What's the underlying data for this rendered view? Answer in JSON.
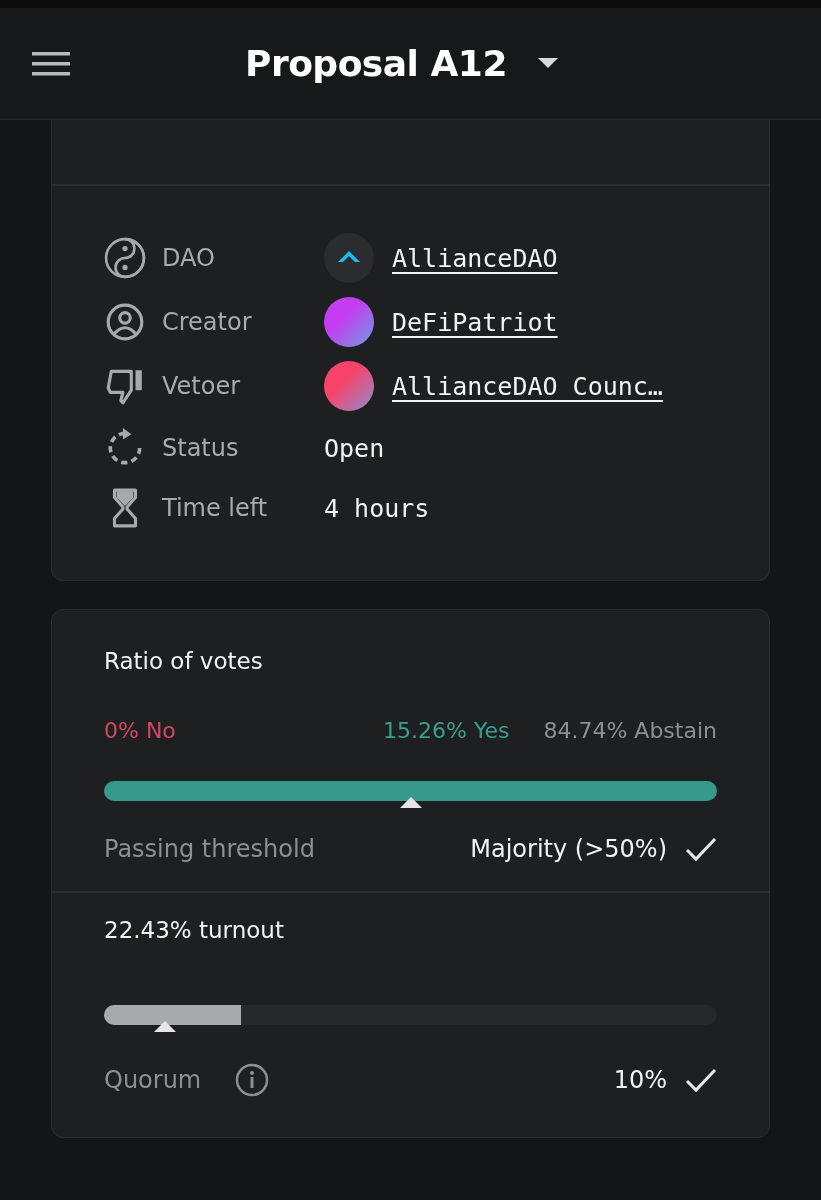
{
  "header": {
    "title": "Proposal A12"
  },
  "details": [
    {
      "kind": "link",
      "label": "DAO",
      "value": "AllianceDAO"
    },
    {
      "kind": "link",
      "label": "Creator",
      "value": "DeFiPatriot"
    },
    {
      "kind": "link",
      "label": "Vetoer",
      "value": "AllianceDAO Counc…"
    },
    {
      "kind": "text",
      "label": "Status",
      "value": "Open"
    },
    {
      "kind": "text",
      "label": "Time left",
      "value": "4 hours"
    }
  ],
  "ratio": {
    "title": "Ratio of votes",
    "options": [
      {
        "label": "0% No",
        "color": "#d2475f"
      },
      {
        "label": "15.26% Yes",
        "color": "#37a090"
      },
      {
        "label": "84.74% Abstain",
        "color": "#8e8f92"
      }
    ],
    "bar": {
      "level": 1.0
    },
    "threshold_marker": {
      "level": 0.5
    },
    "threshold_label": "Passing threshold",
    "threshold_value": "Majority (>50%)",
    "threshold_met": true
  },
  "turnout": {
    "title": "22.43% turnout",
    "bar": {
      "level": 0.2243
    },
    "quorum_marker": {
      "level": 0.1
    },
    "quorum_label": "Quorum",
    "quorum_value": "10%",
    "quorum_met": true
  }
}
